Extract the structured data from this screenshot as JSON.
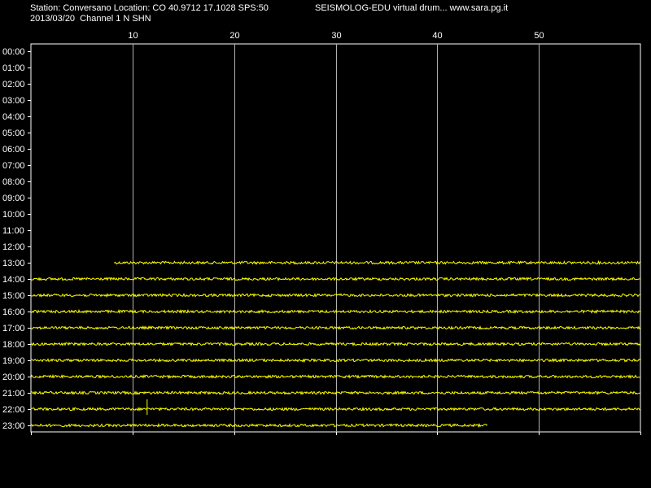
{
  "header": {
    "station_line": "Station: Conversano Location: CO 40.9712 17.1028 SPS:50",
    "date_line": "2013/03/20  Channel 1 N SHN",
    "brand_line": "SEISMOLOG-EDU virtual drum... www.sara.pg.it"
  },
  "colors": {
    "background": "#000000",
    "trace": "#ffff00",
    "grid": "#b0b0b0",
    "axis": "#ffffff",
    "text": "#ffffff"
  },
  "chart_data": {
    "type": "line",
    "title": "",
    "xlabel": "",
    "ylabel": "",
    "x_unit_implied": "minutes",
    "xlim": [
      0,
      60
    ],
    "x_ticks": [
      10,
      20,
      30,
      40,
      50
    ],
    "grid": true,
    "rows": [
      "00:00",
      "01:00",
      "02:00",
      "03:00",
      "04:00",
      "05:00",
      "06:00",
      "07:00",
      "08:00",
      "09:00",
      "10:00",
      "11:00",
      "12:00",
      "13:00",
      "14:00",
      "15:00",
      "16:00",
      "17:00",
      "18:00",
      "19:00",
      "20:00",
      "21:00",
      "22:00",
      "23:00"
    ],
    "traces": [
      {
        "row": "13:00",
        "x_start": 8.2,
        "x_end": 60
      },
      {
        "row": "14:00",
        "x_start": 0,
        "x_end": 60
      },
      {
        "row": "15:00",
        "x_start": 0,
        "x_end": 60
      },
      {
        "row": "16:00",
        "x_start": 0,
        "x_end": 60
      },
      {
        "row": "17:00",
        "x_start": 0,
        "x_end": 60
      },
      {
        "row": "18:00",
        "x_start": 0,
        "x_end": 60
      },
      {
        "row": "19:00",
        "x_start": 0,
        "x_end": 60
      },
      {
        "row": "20:00",
        "x_start": 0,
        "x_end": 60
      },
      {
        "row": "21:00",
        "x_start": 0,
        "x_end": 60
      },
      {
        "row": "22:00",
        "x_start": 0,
        "x_end": 60
      },
      {
        "row": "23:00",
        "x_start": 0,
        "x_end": 45
      }
    ],
    "events": [
      {
        "row": "22:00",
        "x": 11.4
      }
    ]
  }
}
